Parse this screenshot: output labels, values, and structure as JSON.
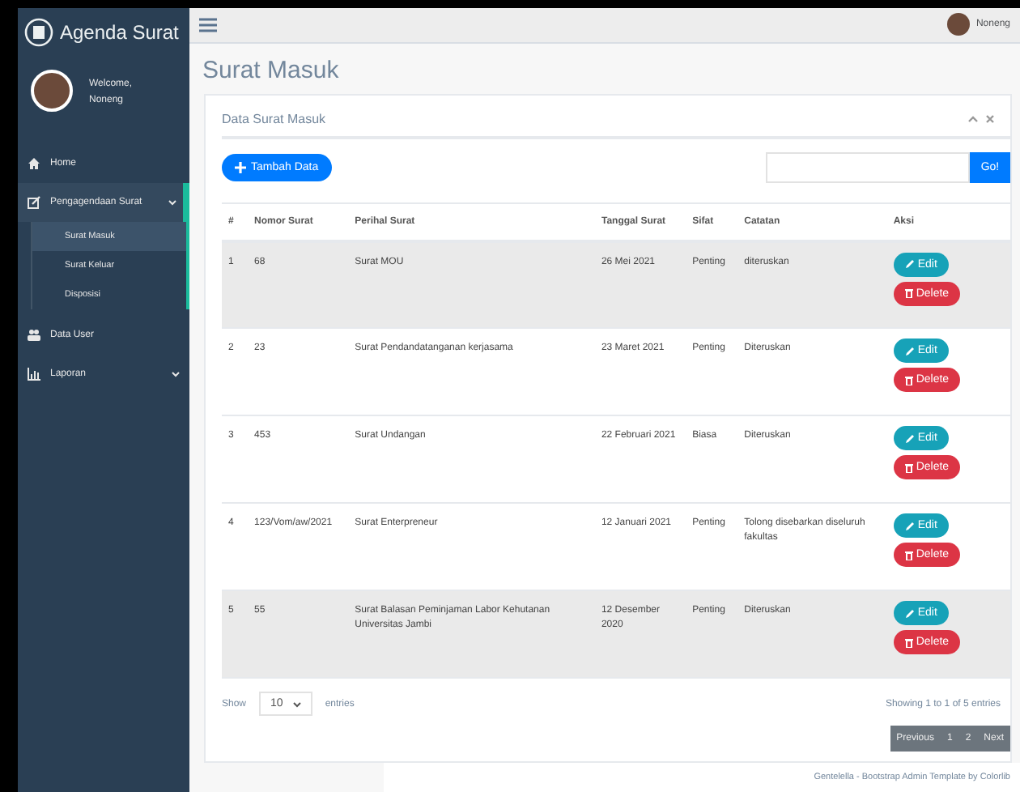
{
  "brand": "Agenda Surat",
  "profile": {
    "welcome": "Welcome,",
    "name": "Noneng"
  },
  "sidebar": {
    "items": [
      {
        "label": "Home",
        "kind": "link"
      },
      {
        "label": "Pengagendaan Surat",
        "kind": "dropdown",
        "expanded": true,
        "children": [
          {
            "label": "Surat Masuk",
            "selected": true
          },
          {
            "label": "Surat Keluar",
            "selected": false
          },
          {
            "label": "Disposisi",
            "selected": false
          }
        ]
      },
      {
        "label": "Data User",
        "kind": "link"
      },
      {
        "label": "Laporan",
        "kind": "dropdown",
        "expanded": false
      }
    ]
  },
  "topbar": {
    "user": "Noneng"
  },
  "page_title": "Surat Masuk",
  "panel": {
    "title": "Data Surat Masuk",
    "add_button": "Tambah Data",
    "go_button": "Go!"
  },
  "table": {
    "columns": [
      "#",
      "Nomor Surat",
      "Perihal Surat",
      "Tanggal Surat",
      "Sifat",
      "Catatan",
      "Aksi"
    ],
    "rows": [
      {
        "cells": [
          "1",
          "68",
          "Surat MOU",
          "26 Mei 2021",
          "Penting",
          "diteruskan"
        ],
        "shaded": true,
        "actions": [
          "Edit",
          "Delete"
        ]
      },
      {
        "cells": [
          "2",
          "23",
          "Surat Pendandatanganan kerjasama",
          "23 Maret 2021",
          "Penting",
          "Diteruskan"
        ],
        "shaded": false,
        "actions": [
          "Edit",
          "Delete"
        ]
      },
      {
        "cells": [
          "3",
          "453",
          "Surat Undangan",
          "22 Februari 2021",
          "Biasa",
          "Diteruskan"
        ],
        "shaded": false,
        "actions": [
          "Edit",
          "Delete"
        ]
      },
      {
        "cells": [
          "4",
          "123/Vom/aw/2021",
          "Surat Enterpreneur",
          "12 Januari 2021",
          "Penting",
          "Tolong disebarkan diseluruh fakultas"
        ],
        "shaded": false,
        "actions": [
          "Edit",
          "Delete"
        ]
      },
      {
        "cells": [
          "5",
          "55",
          "Surat Balasan Peminjaman Labor Kehutanan Universitas Jambi",
          "12 Desember 2020",
          "Penting",
          "Diteruskan"
        ],
        "shaded": true,
        "actions": [
          "Edit",
          "Delete"
        ]
      }
    ]
  },
  "length": {
    "show": "Show",
    "value": "10",
    "entries": "entries"
  },
  "info": "Showing 1 to 1 of 5 entries",
  "pagination": [
    "Previous",
    "1",
    "2",
    "Next"
  ],
  "footer": "Gentelella - Bootstrap Admin Template by Colorlib"
}
